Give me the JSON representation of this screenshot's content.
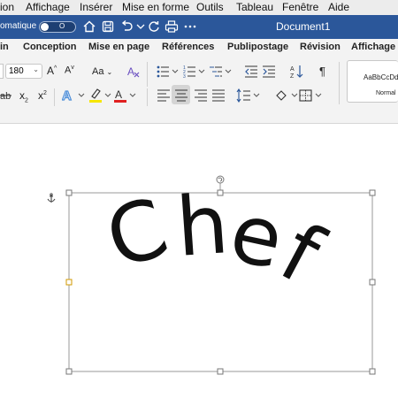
{
  "menubar": {
    "items": [
      "ion",
      "Affichage",
      "Insérer",
      "Mise en forme",
      "Outils",
      "Tableau",
      "Fenêtre",
      "Aide"
    ]
  },
  "titlebar": {
    "autosave_label": "omatique",
    "autosave_state": "O",
    "document_title": "Document1",
    "icons": [
      "home-icon",
      "save-icon",
      "undo-icon",
      "redo-icon",
      "print-icon",
      "more-icon"
    ]
  },
  "tabs": [
    "in",
    "Conception",
    "Mise en page",
    "Références",
    "Publipostage",
    "Révision",
    "Affichage"
  ],
  "ribbon": {
    "font_size": "180",
    "grow_font": "A",
    "shrink_font": "A",
    "case_label": "Aa",
    "subscript": "x",
    "superscript": "x",
    "pilcrow": "¶",
    "colors": {
      "highlight": "#f6e600",
      "font_color": "#e02020",
      "accent": "#2b579a",
      "text_effect": "#4f8fd9"
    },
    "styles_gallery": {
      "sample": "AaBbCcDd",
      "name": "Normal"
    }
  },
  "document": {
    "wordart_text": "Chef",
    "letters": [
      "C",
      "h",
      "e",
      "f"
    ]
  }
}
